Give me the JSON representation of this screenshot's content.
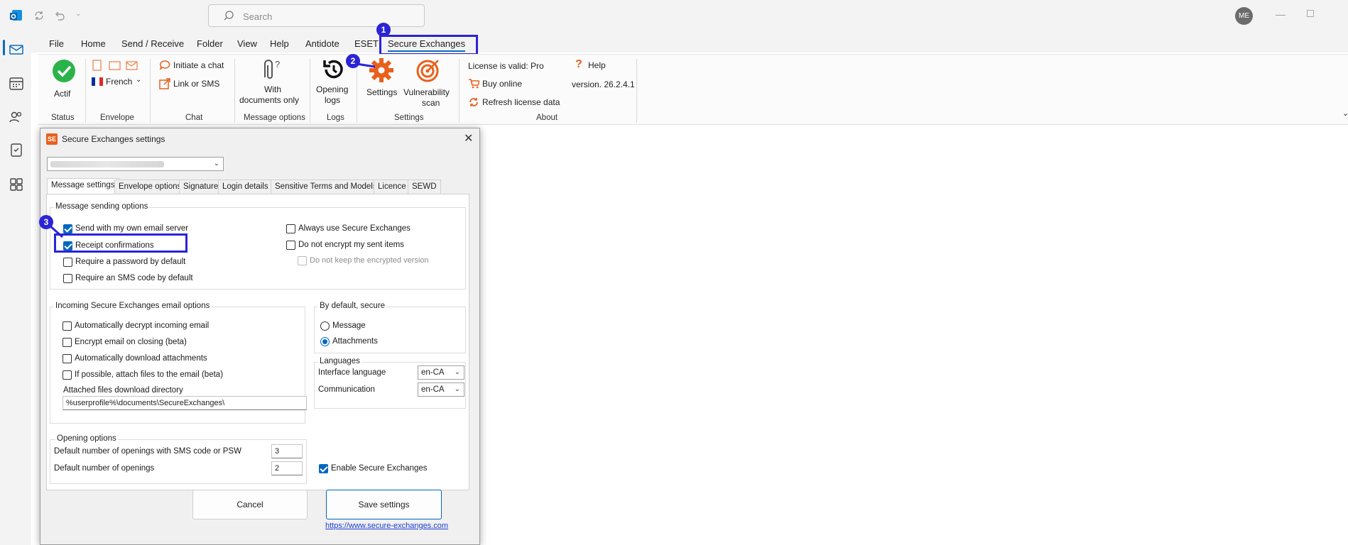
{
  "titlebar": {
    "search_placeholder": "Search",
    "avatar": "ME"
  },
  "menu": [
    "File",
    "Home",
    "Send / Receive",
    "Folder",
    "View",
    "Help",
    "Antidote",
    "ESET",
    "Secure Exchanges"
  ],
  "ribbon": {
    "status": {
      "button": "Actif",
      "group": "Status"
    },
    "envelope": {
      "lang": "French",
      "group": "Envelope"
    },
    "chat": {
      "initiate": "Initiate a chat",
      "link": "Link or SMS",
      "group": "Chat"
    },
    "message_options": {
      "with_docs_line1": "With",
      "with_docs_line2": "documents only",
      "group": "Message options"
    },
    "logs": {
      "btn_line1": "Opening",
      "btn_line2": "logs",
      "group": "Logs"
    },
    "settings": {
      "settings": "Settings",
      "vuln_line1": "Vulnerability",
      "vuln_line2": "scan",
      "group": "Settings"
    },
    "about": {
      "license": "License is valid: Pro",
      "buy": "Buy online",
      "refresh": "Refresh license data",
      "help": "Help",
      "version": "version. 26.2.4.1",
      "group": "About"
    }
  },
  "dialog": {
    "title": "Secure Exchanges settings",
    "tabs": [
      "Message settings",
      "Envelope options",
      "Signature",
      "Login details",
      "Sensitive Terms and Models",
      "Licence",
      "SEWD"
    ],
    "sending": {
      "title": "Message sending options",
      "own_server": "Send with my own email server",
      "receipt": "Receipt confirmations",
      "password": "Require a password by default",
      "sms": "Require an SMS code by default",
      "always": "Always use Secure Exchanges",
      "no_encrypt": "Do not encrypt my sent items",
      "no_keep": "Do not keep the encrypted version"
    },
    "incoming": {
      "title": "Incoming Secure Exchanges email options",
      "auto_decrypt": "Automatically decrypt incoming email",
      "encrypt_closing": "Encrypt email on closing (beta)",
      "auto_download": "Automatically download attachments",
      "attach_files": "If possible, attach files to the email (beta)",
      "dir_label": "Attached files download directory",
      "dir_value": "%userprofile%\\documents\\SecureExchanges\\"
    },
    "default_secure": {
      "title": "By default, secure",
      "message": "Message",
      "attachments": "Attachments"
    },
    "languages": {
      "title": "Languages",
      "interface_label": "Interface language",
      "interface_value": "en-CA",
      "comm_label": "Communication",
      "comm_value": "en-CA"
    },
    "opening": {
      "title": "Opening options",
      "sms_label": "Default number of openings with SMS code or PSW",
      "sms_value": "3",
      "open_label": "Default number of openings",
      "open_value": "2"
    },
    "enable": "Enable Secure Exchanges",
    "cancel": "Cancel",
    "save": "Save settings",
    "link": "https://www.secure-exchanges.com"
  },
  "callouts": [
    "1",
    "2",
    "3"
  ],
  "colors": {
    "accent": "#2b24d6",
    "checkbox": "#0067c0",
    "orange": "#e8601c"
  }
}
